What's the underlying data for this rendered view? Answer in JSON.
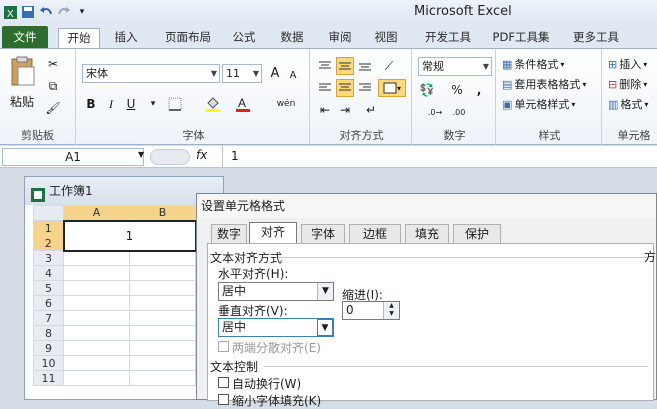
{
  "app_title": "Microsoft Excel",
  "qat": {
    "icons": [
      "excel-logo-icon",
      "save-icon",
      "undo-icon",
      "redo-icon",
      "customize-icon"
    ]
  },
  "tabs": [
    {
      "label": "文件"
    },
    {
      "label": "开始"
    },
    {
      "label": "插入"
    },
    {
      "label": "页面布局"
    },
    {
      "label": "公式"
    },
    {
      "label": "数据"
    },
    {
      "label": "审阅"
    },
    {
      "label": "视图"
    },
    {
      "label": "开发工具"
    },
    {
      "label": "PDF工具集"
    },
    {
      "label": "更多工具"
    }
  ],
  "ribbon": {
    "clipboard": {
      "label": "剪贴板",
      "paste": "粘贴"
    },
    "font": {
      "label": "字体",
      "name": "宋体",
      "size": "11",
      "bold": "B",
      "italic": "I",
      "underline": "U",
      "grow": "A",
      "shrink": "A",
      "wen": "wén"
    },
    "alignment": {
      "label": "对齐方式"
    },
    "number": {
      "label": "数字",
      "format": "常规",
      "percent": "%",
      "comma": ","
    },
    "styles": {
      "label": "样式",
      "items": [
        "条件格式",
        "套用表格格式",
        "单元格样式"
      ]
    },
    "cells": {
      "label": "单元格",
      "items": [
        "插入",
        "删除",
        "格式"
      ]
    }
  },
  "formula_bar": {
    "name_box": "A1",
    "fx": "fx",
    "value": "1"
  },
  "workbook": {
    "title": "工作簿1",
    "columns": [
      "A",
      "B"
    ],
    "rows": [
      "1",
      "2",
      "3",
      "4",
      "5",
      "6",
      "7",
      "8",
      "9",
      "10",
      "11"
    ],
    "a1_value": "1"
  },
  "dialog": {
    "title": "设置单元格格式",
    "tabs": [
      "数字",
      "对齐",
      "字体",
      "边框",
      "填充",
      "保护"
    ],
    "active_tab": "对齐",
    "section_align": "文本对齐方式",
    "horizontal_label": "水平对齐(H):",
    "horizontal_value": "居中",
    "indent_label": "缩进(I):",
    "indent_value": "0",
    "vertical_label": "垂直对齐(V):",
    "vertical_value": "居中",
    "distributed_label": "两端分散对齐(E)",
    "section_control": "文本控制",
    "wrap_label": "自动换行(W)",
    "shrink_label": "缩小字体填充(K)",
    "right_edge": "方"
  }
}
